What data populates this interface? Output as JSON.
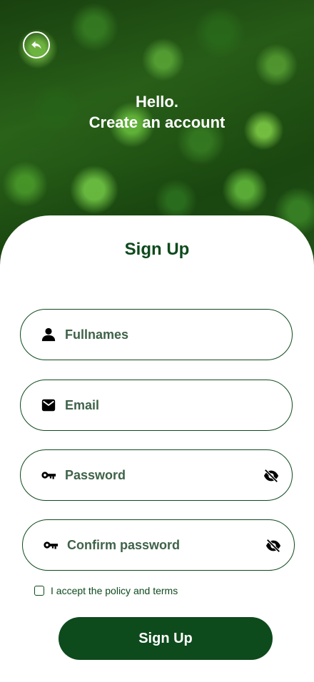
{
  "header": {
    "greeting": "Hello.",
    "subtitle": "Create an account"
  },
  "form": {
    "title": "Sign Up",
    "fields": [
      {
        "name": "fullnames",
        "placeholder": "Fullnames",
        "icon": "user-icon"
      },
      {
        "name": "email",
        "placeholder": "Email",
        "icon": "mail-icon"
      },
      {
        "name": "password",
        "placeholder": "Password",
        "icon": "key-icon",
        "toggle_icon": "eye-off-icon"
      },
      {
        "name": "confirm_password",
        "placeholder": "Confirm password",
        "icon": "key-icon",
        "toggle_icon": "eye-off-icon"
      }
    ],
    "terms_label": "I accept the policy and terms",
    "submit_label": "Sign Up"
  },
  "colors": {
    "brand_dark_green": "#0d4a1c",
    "placeholder_text": "#3f6248",
    "background": "#ffffff"
  }
}
